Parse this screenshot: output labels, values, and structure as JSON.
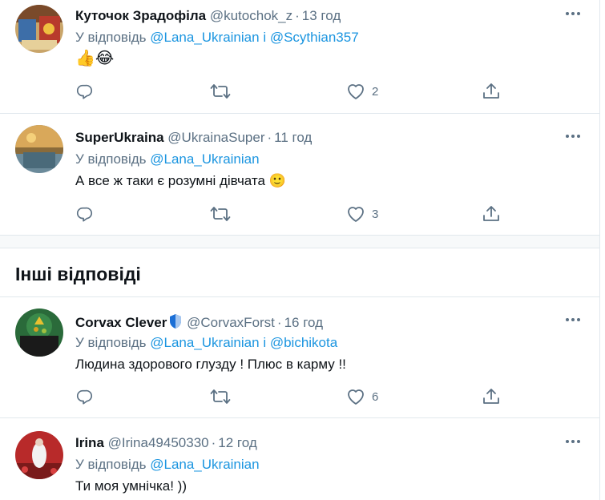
{
  "colors": {
    "accent": "#1b95e0",
    "muted": "#5b7083",
    "text": "#0f1419",
    "border": "#e1e8ed"
  },
  "tweets_top": [
    {
      "name": "Куточок Зрадофіла",
      "handle": "@kutochok_z",
      "time": "13 год",
      "reply_prefix": "У відповідь",
      "mentions": [
        "@Lana_Ukrainian",
        "@Scythian357"
      ],
      "mention_joiner": "і",
      "text": "👍😂",
      "likes": "2",
      "icons": [
        "reply-icon",
        "retweet-icon",
        "like-icon",
        "share-icon",
        "more-icon"
      ]
    },
    {
      "name": "SuperUkraina",
      "handle": "@UkrainaSuper",
      "time": "11 год",
      "reply_prefix": "У відповідь",
      "mentions": [
        "@Lana_Ukrainian"
      ],
      "text": "А все ж таки є розумні дівчата 🙂",
      "likes": "3"
    }
  ],
  "section": {
    "title": "Інші відповіді"
  },
  "tweets_other": [
    {
      "name": "Corvax Clever",
      "handle": "@CorvaxForst",
      "time": "16 год",
      "reply_prefix": "У відповідь",
      "mentions": [
        "@Lana_Ukrainian",
        "@bichikota"
      ],
      "mention_joiner": "і",
      "text": "Людина здорового глузду ! Плюс в карму !!",
      "likes": "6"
    },
    {
      "name": "Irina",
      "handle": "@Irina49450330",
      "time": "12 год",
      "reply_prefix": "У відповідь",
      "mentions": [
        "@Lana_Ukrainian"
      ],
      "text": "Ти моя умнічка! ))"
    }
  ],
  "separator_dot": "·"
}
